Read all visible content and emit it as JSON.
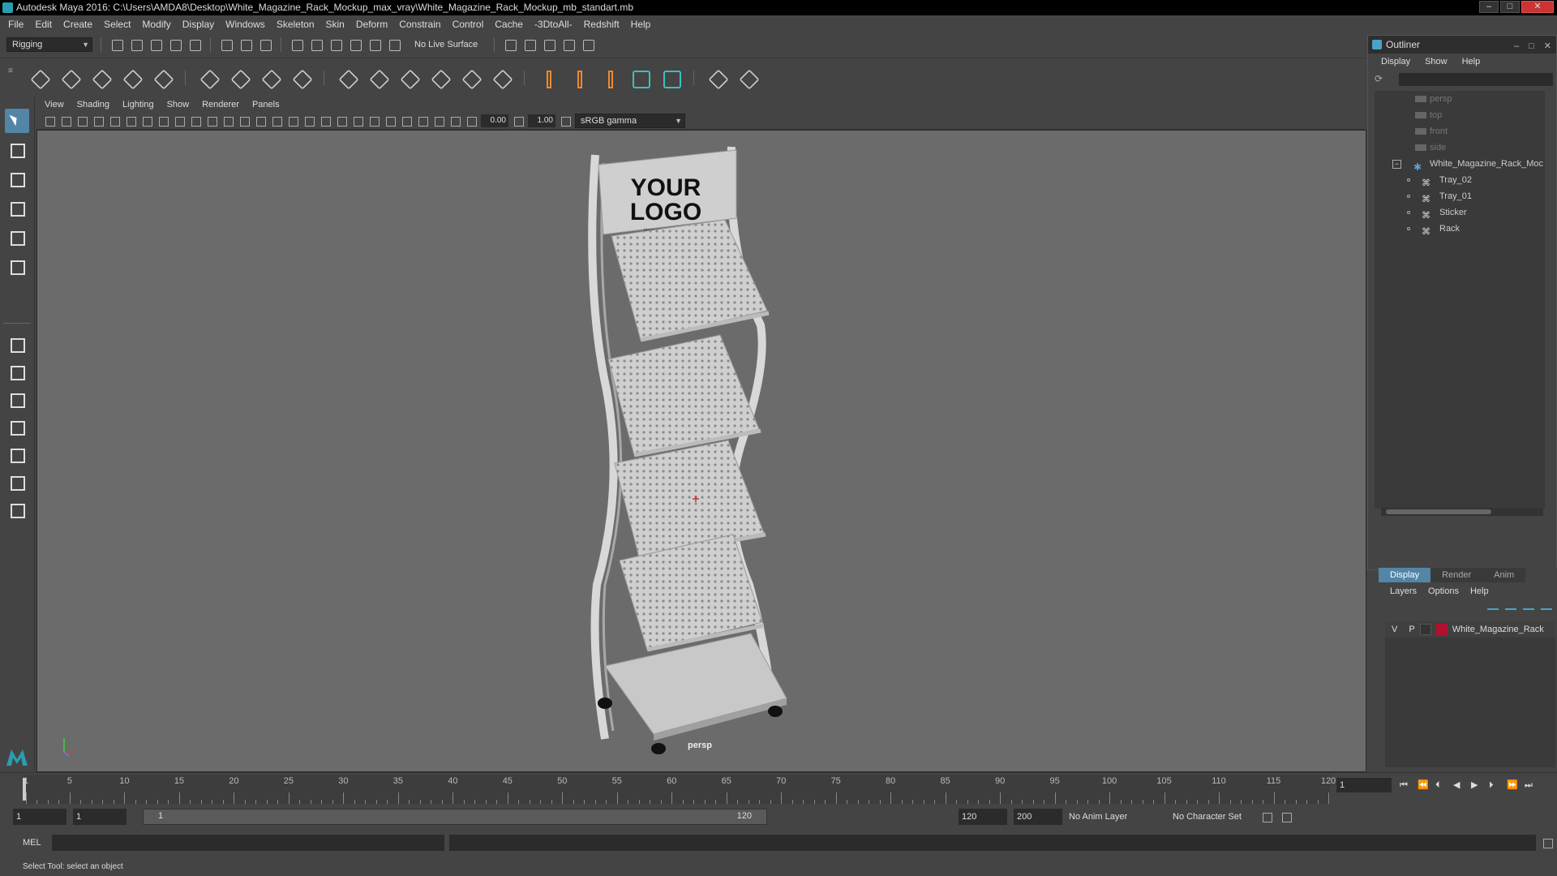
{
  "window": {
    "title": "Autodesk Maya 2016: C:\\Users\\AMDA8\\Desktop\\White_Magazine_Rack_Mockup_max_vray\\White_Magazine_Rack_Mockup_mb_standart.mb",
    "controls": [
      "–",
      "□",
      "✕"
    ]
  },
  "menubar": [
    "File",
    "Edit",
    "Create",
    "Select",
    "Modify",
    "Display",
    "Windows",
    "Skeleton",
    "Skin",
    "Deform",
    "Constrain",
    "Control",
    "Cache",
    "-3DtoAll-",
    "Redshift",
    "Help"
  ],
  "statusline": {
    "menuset": "Rigging",
    "live_surface": "No Live Surface"
  },
  "panel": {
    "menus": [
      "View",
      "Shading",
      "Lighting",
      "Show",
      "Renderer",
      "Panels"
    ],
    "near_value": "0.00",
    "far_value": "1.00",
    "color_space": "sRGB gamma",
    "camera_label": "persp"
  },
  "model": {
    "logo_line1": "YOUR",
    "logo_line2": "LOGO",
    "tagline": "place here your tagline"
  },
  "outliner": {
    "title": "Outliner",
    "menus": [
      "Display",
      "Show",
      "Help"
    ],
    "items": [
      {
        "label": "persp",
        "dim": true
      },
      {
        "label": "top",
        "dim": true
      },
      {
        "label": "front",
        "dim": true
      },
      {
        "label": "side",
        "dim": true
      },
      {
        "label": "White_Magazine_Rack_Moc",
        "dim": false
      },
      {
        "label": "Tray_02",
        "dim": false
      },
      {
        "label": "Tray_01",
        "dim": false
      },
      {
        "label": "Sticker",
        "dim": false
      },
      {
        "label": "Rack",
        "dim": false
      }
    ]
  },
  "layers": {
    "tabs": [
      "Display",
      "Render",
      "Anim"
    ],
    "menus": [
      "Layers",
      "Options",
      "Help"
    ],
    "row": {
      "v": "V",
      "p": "P",
      "name": "White_Magazine_Rack",
      "color": "#b0122e"
    }
  },
  "timeline": {
    "tick_labels": [
      "1",
      "5",
      "10",
      "15",
      "20",
      "25",
      "30",
      "35",
      "40",
      "45",
      "50",
      "55",
      "60",
      "65",
      "70",
      "75",
      "80",
      "85",
      "90",
      "95",
      "100",
      "105",
      "110",
      "115",
      "120"
    ],
    "current_frame": "1"
  },
  "range": {
    "start": "1",
    "current": "1",
    "slider_start": "1",
    "slider_end": "120",
    "end": "120",
    "max": "200",
    "anim_layer": "No Anim Layer",
    "character_set": "No Character Set"
  },
  "command": {
    "lang": "MEL"
  },
  "helpline": "Select Tool: select an object"
}
